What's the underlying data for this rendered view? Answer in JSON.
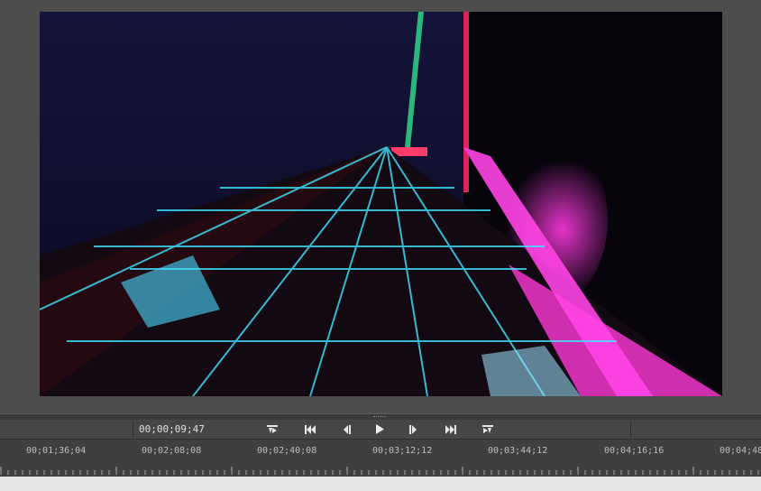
{
  "player": {
    "current_timecode": "00;00;09;47",
    "controls": {
      "go_to_in": "go-to-in-point",
      "prev_keyframe": "previous-edit",
      "step_back": "step-back",
      "play": "play",
      "step_forward": "step-forward",
      "next_keyframe": "next-edit",
      "go_to_out": "go-to-out-point"
    }
  },
  "timeline": {
    "ruler_labels": [
      "00;01;36;04",
      "00;02;08;08",
      "00;02;40;08",
      "00;03;12;12",
      "00;03;44;12",
      "00;04;16;16",
      "00;04;48;"
    ]
  },
  "colors": {
    "background": "#4b4b4b",
    "accent_magenta": "#ff2fd0",
    "accent_cyan": "#3fe6ff"
  }
}
